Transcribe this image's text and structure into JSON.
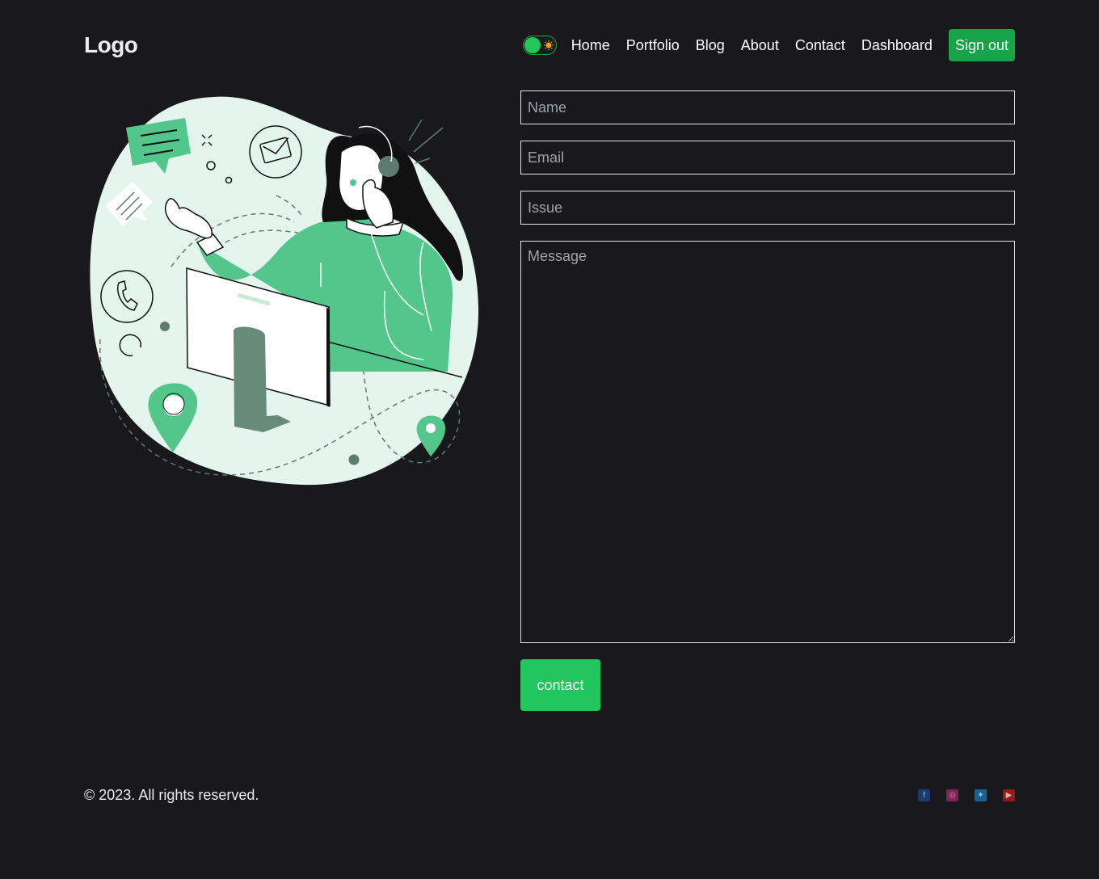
{
  "header": {
    "logo": "Logo",
    "nav": [
      "Home",
      "Portfolio",
      "Blog",
      "About",
      "Contact",
      "Dashboard"
    ],
    "sign_out_label": "Sign out",
    "theme_toggle": {
      "state": "dark",
      "knob_color": "#22c55e",
      "sun_color": "#f59e0b"
    }
  },
  "form": {
    "name_placeholder": "Name",
    "email_placeholder": "Email",
    "issue_placeholder": "Issue",
    "message_placeholder": "Message",
    "submit_label": "contact"
  },
  "footer": {
    "copyright": "© 2023. All rights reserved.",
    "social": [
      {
        "icon": "facebook-icon",
        "glyph": "f",
        "color": "#1e3a6e",
        "fg": "#6b8ed6"
      },
      {
        "icon": "instagram-icon",
        "glyph": "◎",
        "color": "#7b2457",
        "fg": "#e879b9"
      },
      {
        "icon": "twitter-icon",
        "glyph": "🐦",
        "color": "#1f5f8b",
        "fg": "#93c5fd"
      },
      {
        "icon": "youtube-icon",
        "glyph": "▶",
        "color": "#8b1d1d",
        "fg": "#fca5a5"
      }
    ]
  },
  "colors": {
    "background": "#19191b",
    "accent": "#22c55e",
    "accent_dark": "#16a34a",
    "illustration_green": "#52c68b",
    "illustration_bg": "#e3f5ec"
  }
}
